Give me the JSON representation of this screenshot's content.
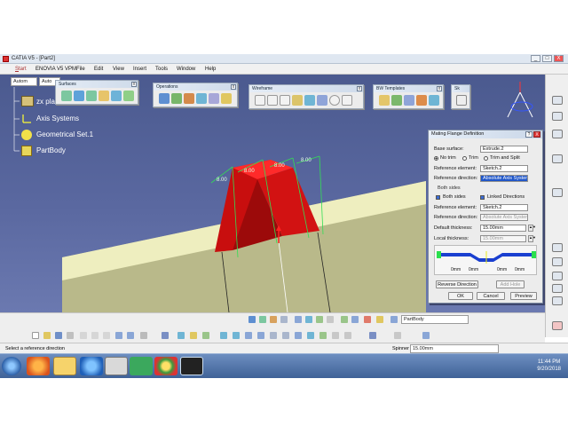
{
  "window": {
    "title": "CATIA V5 - [Part2]",
    "min": "_",
    "max": "□",
    "close": "X"
  },
  "menu": {
    "items": [
      "Start",
      "ENOVIA V5 VPM",
      "File",
      "Edit",
      "View",
      "Insert",
      "Tools",
      "Window",
      "Help"
    ]
  },
  "toolbars": {
    "surfaces": "Surfaces",
    "operations": "Operations",
    "wireframe": "Wireframe",
    "bw_templates": "BW Templates",
    "sk": "Sk",
    "combo1": "Autom",
    "combo2": "Auto"
  },
  "tree": {
    "plane_partial": "zx pla",
    "items": [
      "Axis Systems",
      "Geometrical Set.1",
      "PartBody"
    ]
  },
  "viewport": {
    "dimensions": [
      "8.00",
      "8.00",
      "8.00",
      "8.00"
    ]
  },
  "dialog": {
    "title": "Mating Flange Definition",
    "help": "?",
    "close": "X",
    "base_surface_label": "Base surface:",
    "base_surface_value": "Extrude.2",
    "trim_options": [
      "No trim",
      "Trim",
      "Trim and Split"
    ],
    "trim_selected": "No trim",
    "ref_element_label": "Reference element:",
    "ref_element_value": "Sketch.2",
    "ref_direction_label": "Reference direction:",
    "ref_direction_value": "Absolute Axis System",
    "both_sides_section": "Both sides",
    "both_sides_check": "Both sides",
    "linked_directions_check": "Linked Directions",
    "ref_element2_label": "Reference element:",
    "ref_element2_value": "Sketch.2",
    "ref_direction2_label": "Reference direction:",
    "ref_direction2_value": "Absolute Axis System",
    "default_thickness_label": "Default thickness:",
    "default_thickness_value": "15.00mm",
    "local_thickness_label": "Local thickness:",
    "local_thickness_value": "15.00mm",
    "preview_dims": [
      "0mm",
      "0mm",
      "0mm",
      "0mm"
    ],
    "reverse_direction": "Reverse Direction",
    "other_button": "Add Hole",
    "ok": "OK",
    "cancel": "Cancel",
    "preview": "Preview"
  },
  "bottom": {
    "body_combo": "PartBody"
  },
  "status": {
    "prompt": "Select a reference direction",
    "spinner_label": "Spinner",
    "spinner_value": "15.00mm"
  },
  "taskbar": {
    "time": "11:44 PM",
    "date": "9/20/2018"
  },
  "colors": {
    "viewport_bg": "#5563a0",
    "flange_red": "#e01414",
    "surface_beige": "#efefc0",
    "selection_blue": "#1f56c9"
  }
}
